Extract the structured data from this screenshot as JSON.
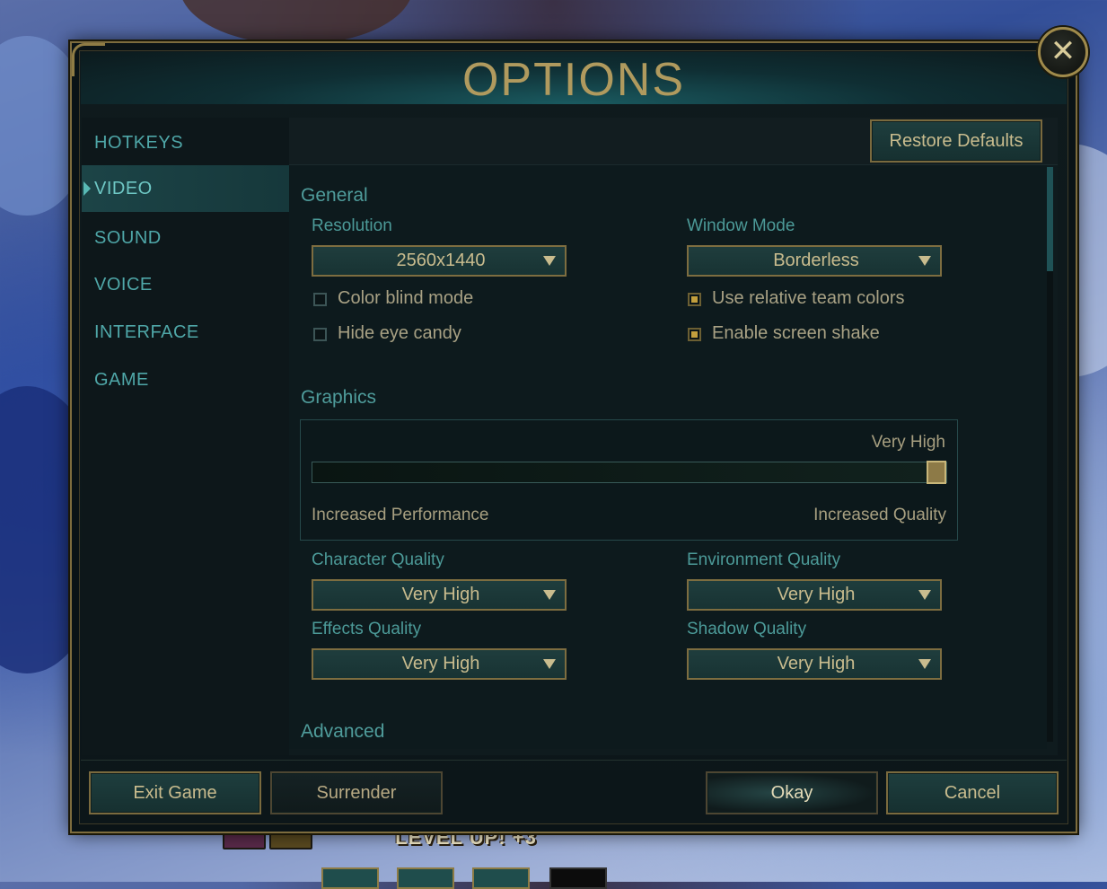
{
  "game_hud": {
    "level_up_text": "LEVEL UP! +3"
  },
  "dialog": {
    "title": "OPTIONS",
    "close_symbol": "✕",
    "restore_defaults": "Restore Defaults"
  },
  "sidebar": {
    "items": [
      {
        "label": "HOTKEYS",
        "active": false
      },
      {
        "label": "VIDEO",
        "active": true
      },
      {
        "label": "SOUND",
        "active": false
      },
      {
        "label": "VOICE",
        "active": false
      },
      {
        "label": "INTERFACE",
        "active": false
      },
      {
        "label": "GAME",
        "active": false
      }
    ]
  },
  "general": {
    "section_title": "General",
    "resolution": {
      "label": "Resolution",
      "value": "2560x1440"
    },
    "window_mode": {
      "label": "Window Mode",
      "value": "Borderless"
    },
    "checkboxes": {
      "color_blind": {
        "label": "Color blind mode",
        "checked": false
      },
      "hide_eye_candy": {
        "label": "Hide eye candy",
        "checked": false
      },
      "relative_team_colors": {
        "label": "Use relative team colors",
        "checked": true
      },
      "screen_shake": {
        "label": "Enable screen shake",
        "checked": true
      }
    }
  },
  "graphics": {
    "section_title": "Graphics",
    "level_label": "Very High",
    "slider_value": 1.0,
    "left_label": "Increased Performance",
    "right_label": "Increased Quality",
    "character_quality": {
      "label": "Character Quality",
      "value": "Very High"
    },
    "environment_quality": {
      "label": "Environment Quality",
      "value": "Very High"
    },
    "effects_quality": {
      "label": "Effects Quality",
      "value": "Very High"
    },
    "shadow_quality": {
      "label": "Shadow Quality",
      "value": "Very High"
    }
  },
  "advanced": {
    "section_title": "Advanced"
  },
  "footer": {
    "exit_game": "Exit Game",
    "surrender": "Surrender",
    "okay": "Okay",
    "cancel": "Cancel"
  },
  "colors": {
    "accent_gold": "#b09a5e",
    "teal_text": "#4fa7a8",
    "checkbox_on": "#c29f3d"
  }
}
